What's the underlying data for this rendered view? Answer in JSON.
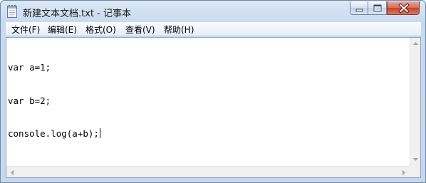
{
  "window": {
    "title": "新建文本文档.txt - 记事本",
    "icon": "notepad-icon",
    "caption_buttons": [
      "minimize-icon",
      "maximize-icon",
      "close-icon"
    ]
  },
  "menu": {
    "items": [
      {
        "label": "文件(F)"
      },
      {
        "label": "编辑(E)"
      },
      {
        "label": "格式(O)"
      },
      {
        "label": "查看(V)"
      },
      {
        "label": "帮助(H)"
      }
    ]
  },
  "editor": {
    "lines": [
      "var a=1;",
      "var b=2;",
      "console.log(a+b);"
    ]
  },
  "colors": {
    "frame": "#c7d8ee",
    "close_button": "#c3402a",
    "editor_background": "#ffffff"
  }
}
